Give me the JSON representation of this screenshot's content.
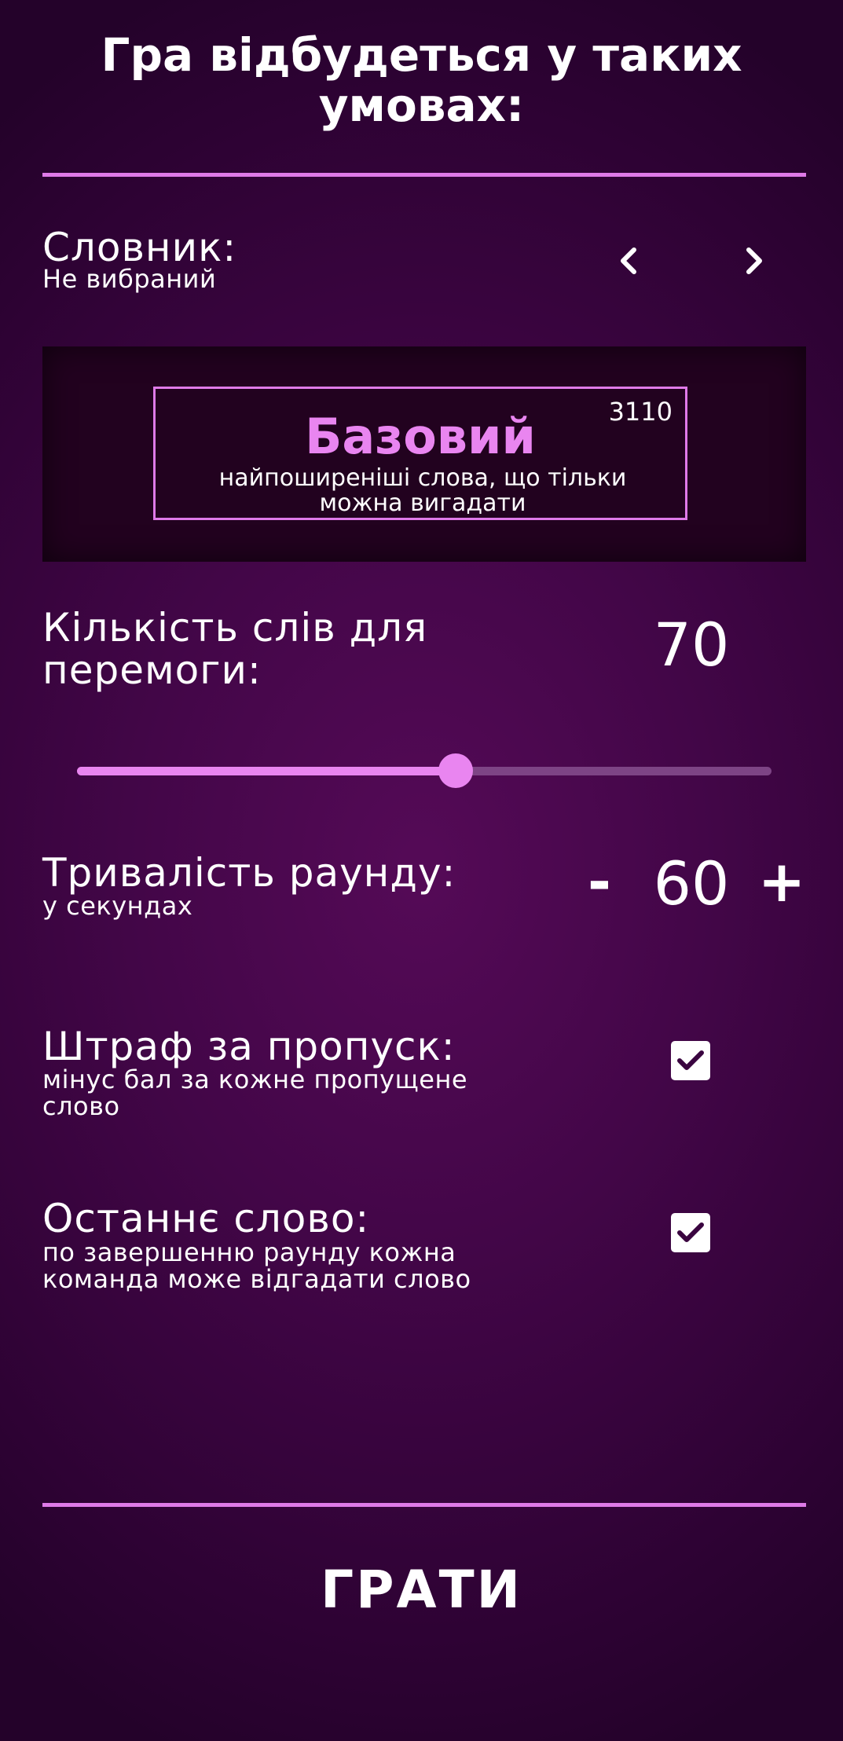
{
  "header": {
    "title": "Гра відбудеться у таких\nумовах:"
  },
  "dictionary": {
    "label": "Словник:",
    "status": "Не вибраний",
    "prev_icon": "chevron-left-icon",
    "next_icon": "chevron-right-icon",
    "card": {
      "count": "3110",
      "name": "Базовий",
      "description": "найпоширеніші слова, що тільки\nможна вигадати"
    }
  },
  "words_to_win": {
    "label": "Кількість слів для\nперемоги:",
    "value": "70",
    "slider_fraction": 0.545
  },
  "round_duration": {
    "label": "Тривалість раунду:",
    "sublabel": "у секундах",
    "minus": "-",
    "value": "60",
    "plus": "+"
  },
  "skip_penalty": {
    "label": "Штраф за пропуск:",
    "sublabel": "мінус бал за кожне пропущене\nслово",
    "checked": true
  },
  "last_word": {
    "label": "Останнє слово:",
    "sublabel": "по завершенню раунду кожна\nкоманда може відгадати слово",
    "checked": true
  },
  "play_button": {
    "label": "ГРАТИ"
  },
  "colors": {
    "accent": "#df7ae8",
    "accent_light": "#e985f0",
    "background": "#430648",
    "text": "#ffffff"
  }
}
